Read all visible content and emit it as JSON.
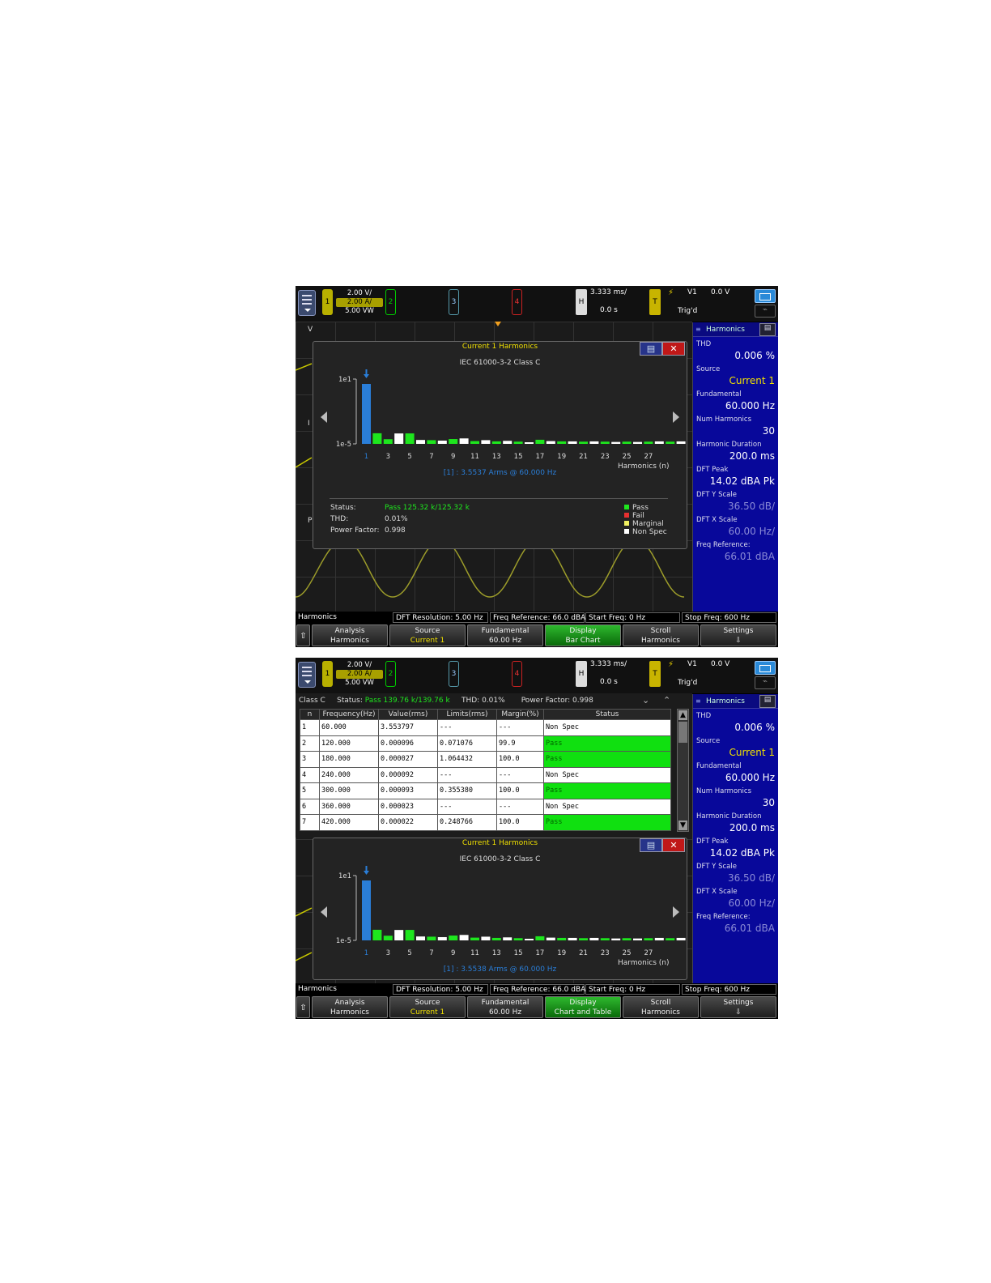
{
  "scope": {
    "ch1_scale": "2.00 V/",
    "ch_current_scale": "2.00 A/",
    "ch_power_scale": "5.00 VW",
    "ch1": "1",
    "ch2": "2",
    "ch3": "3",
    "ch4": "4",
    "h_label": "H",
    "time_div": "3.333 ms/",
    "delay": "0.0 s",
    "t_label": "T",
    "trig_source": "V1",
    "trig_level": "0.0 V",
    "trig_state": "Trig'd"
  },
  "right_panel": {
    "title": "Harmonics",
    "items": [
      {
        "label": "THD",
        "value": "0.006 %",
        "dim": false
      },
      {
        "label": "Source",
        "value": "Current 1",
        "dim": false,
        "yellow": true
      },
      {
        "label": "Fundamental",
        "value": "60.000 Hz",
        "dim": false
      },
      {
        "label": "Num Harmonics",
        "value": "30",
        "dim": false
      },
      {
        "label": "Harmonic Duration",
        "value": "200.0 ms",
        "dim": false
      },
      {
        "label": "DFT Peak",
        "value": "14.02 dBA Pk",
        "dim": false
      },
      {
        "label": "DFT Y Scale",
        "value": "36.50 dB/",
        "dim": true
      },
      {
        "label": "DFT X Scale",
        "value": "60.00 Hz/",
        "dim": true
      },
      {
        "label": "Freq Reference:",
        "value": "66.01 dBA",
        "dim": true
      }
    ]
  },
  "status_strip": {
    "label": "Harmonics",
    "dft_res": "DFT Resolution: 5.00 Hz",
    "freq_ref": "Freq Reference: 66.0 dBA",
    "start_freq": "Start Freq: 0 Hz",
    "stop_freq": "Stop Freq: 600 Hz"
  },
  "softkeys": {
    "analysis": {
      "t": "Analysis",
      "v": "Harmonics"
    },
    "source": {
      "t": "Source",
      "v": "Current 1"
    },
    "fundamental": {
      "t": "Fundamental",
      "v": "60.00 Hz"
    },
    "display_bar": {
      "t": "Display",
      "v": "Bar Chart"
    },
    "display_table": {
      "t": "Display",
      "v": "Chart and Table"
    },
    "scroll": {
      "t": "Scroll",
      "v": "Harmonics"
    },
    "settings": {
      "t": "Settings",
      "v": "⇩"
    }
  },
  "dialog": {
    "title": "Current 1 Harmonics",
    "standard": "IEC 61000-3-2 Class C",
    "close_icon": "✕",
    "y_top": "1e1",
    "y_bottom": "1e-5",
    "x_title": "Harmonics (n)",
    "cursor_readout_1": "[1] : 3.5537 Arms @ 60.000 Hz",
    "cursor_readout_2": "[1] : 3.5538 Arms @ 60.000 Hz",
    "status_label": "Status:",
    "status_value": "Pass   125.32 k/125.32 k",
    "thd_label": "THD:",
    "thd_value": "0.01%",
    "pf_label": "Power Factor:",
    "pf_value": "0.998",
    "legend": [
      {
        "label": "Pass",
        "color": "#1ee61e"
      },
      {
        "label": "Fail",
        "color": "#e83030"
      },
      {
        "label": "Marginal",
        "color": "#f0f060"
      },
      {
        "label": "Non Spec",
        "color": "#ffffff"
      }
    ]
  },
  "chart_data": {
    "type": "bar",
    "categories": [
      "1",
      "2",
      "3",
      "4",
      "5",
      "6",
      "7",
      "8",
      "9",
      "10",
      "11",
      "12",
      "13",
      "14",
      "15",
      "16",
      "17",
      "18",
      "19",
      "20",
      "21",
      "22",
      "23",
      "24",
      "25",
      "26",
      "27",
      "28",
      "29",
      "30"
    ],
    "x_tick_labels": [
      "1",
      "3",
      "5",
      "7",
      "9",
      "11",
      "13",
      "15",
      "17",
      "19",
      "21",
      "23",
      "25",
      "27"
    ],
    "y_scale": "log",
    "ylim": [
      1e-05,
      10
    ],
    "values": [
      3.55,
      9.6e-05,
      2.7e-05,
      9.2e-05,
      9.3e-05,
      2.3e-05,
      2.2e-05,
      2e-05,
      2.8e-05,
      3.2e-05,
      1.8e-05,
      2.2e-05,
      1.7e-05,
      1.9e-05,
      1.6e-05,
      1.4e-05,
      2.4e-05,
      1.8e-05,
      1.7e-05,
      1.7e-05,
      1.6e-05,
      1.7e-05,
      1.6e-05,
      1.5e-05,
      1.6e-05,
      1.5e-05,
      1.6e-05,
      1.7e-05,
      1.6e-05,
      1.7e-05
    ],
    "status": [
      "Non Spec",
      "Pass",
      "Pass",
      "Non Spec",
      "Pass",
      "Non Spec",
      "Pass",
      "Non Spec",
      "Pass",
      "Non Spec",
      "Pass",
      "Non Spec",
      "Pass",
      "Non Spec",
      "Pass",
      "Non Spec",
      "Pass",
      "Non Spec",
      "Pass",
      "Non Spec",
      "Pass",
      "Non Spec",
      "Pass",
      "Non Spec",
      "Pass",
      "Non Spec",
      "Pass",
      "Non Spec",
      "Pass",
      "Non Spec"
    ],
    "colors": {
      "Pass": "#1ee61e",
      "Non Spec": "#ffffff",
      "fundamental": "#2a7ed8"
    }
  },
  "table": {
    "class_label": "Class C",
    "status_label": "Status:",
    "status_value": "Pass 139.76 k/139.76 k",
    "thd": "THD: 0.01%",
    "pf": "Power Factor: 0.998",
    "columns": [
      "n",
      "Frequency(Hz)",
      "Value(rms)",
      "Limits(rms)",
      "Margin(%)",
      "Status"
    ],
    "rows": [
      [
        "1",
        "60.000",
        "3.553797",
        "---",
        "---",
        "Non Spec"
      ],
      [
        "2",
        "120.000",
        "0.000096",
        "0.071076",
        "99.9",
        "Pass"
      ],
      [
        "3",
        "180.000",
        "0.000027",
        "1.064432",
        "100.0",
        "Pass"
      ],
      [
        "4",
        "240.000",
        "0.000092",
        "---",
        "---",
        "Non Spec"
      ],
      [
        "5",
        "300.000",
        "0.000093",
        "0.355380",
        "100.0",
        "Pass"
      ],
      [
        "6",
        "360.000",
        "0.000023",
        "---",
        "---",
        "Non Spec"
      ],
      [
        "7",
        "420.000",
        "0.000022",
        "0.248766",
        "100.0",
        "Pass"
      ]
    ]
  }
}
